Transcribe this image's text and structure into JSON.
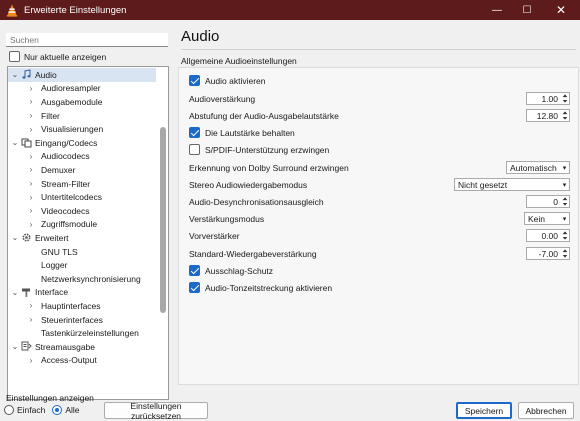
{
  "window": {
    "title": "Erweiterte Einstellungen",
    "minimize": "—",
    "maximize": "☐",
    "close": "✕"
  },
  "sidebar": {
    "search_placeholder": "Suchen",
    "only_current_label": "Nur aktuelle anzeigen",
    "only_current_checked": false,
    "tree": [
      {
        "label": "Audio",
        "level": 0,
        "expanded": true,
        "icon": "music-note-icon",
        "selected": true
      },
      {
        "label": "Audioresampler",
        "level": 1,
        "arrow": true
      },
      {
        "label": "Ausgabemodule",
        "level": 1,
        "arrow": true
      },
      {
        "label": "Filter",
        "level": 1,
        "arrow": true
      },
      {
        "label": "Visualisierungen",
        "level": 1,
        "arrow": true
      },
      {
        "label": "Eingang/Codecs",
        "level": 0,
        "expanded": true,
        "icon": "codec-icon"
      },
      {
        "label": "Audiocodecs",
        "level": 1,
        "arrow": true
      },
      {
        "label": "Demuxer",
        "level": 1,
        "arrow": true
      },
      {
        "label": "Stream-Filter",
        "level": 1,
        "arrow": true
      },
      {
        "label": "Untertitelcodecs",
        "level": 1,
        "arrow": true
      },
      {
        "label": "Videocodecs",
        "level": 1,
        "arrow": true
      },
      {
        "label": "Zugriffsmodule",
        "level": 1,
        "arrow": true
      },
      {
        "label": "Erweitert",
        "level": 0,
        "expanded": true,
        "icon": "gear-icon"
      },
      {
        "label": "GNU TLS",
        "level": 1,
        "arrow": false
      },
      {
        "label": "Logger",
        "level": 1,
        "arrow": false
      },
      {
        "label": "Netzwerksynchronisierung",
        "level": 1,
        "arrow": false
      },
      {
        "label": "Interface",
        "level": 0,
        "expanded": true,
        "icon": "brush-icon"
      },
      {
        "label": "Hauptinterfaces",
        "level": 1,
        "arrow": true
      },
      {
        "label": "Steuerinterfaces",
        "level": 1,
        "arrow": true
      },
      {
        "label": "Tastenkürzeleinstellungen",
        "level": 1,
        "arrow": false
      },
      {
        "label": "Streamausgabe",
        "level": 0,
        "expanded": true,
        "icon": "stream-icon"
      },
      {
        "label": "Access-Output",
        "level": 1,
        "arrow": true
      }
    ]
  },
  "footer": {
    "show_settings_label": "Einstellungen anzeigen",
    "simple_label": "Einfach",
    "all_label": "Alle",
    "selected_mode": "Alle",
    "reset_label": "Einstellungen zurücksetzen",
    "save_label": "Speichern",
    "cancel_label": "Abbrechen"
  },
  "panel": {
    "title": "Audio",
    "subtitle": "Allgemeine Audioeinstellungen",
    "settings": [
      {
        "type": "checkbox",
        "label": "Audio aktivieren",
        "checked": true
      },
      {
        "type": "spin",
        "label": "Audioverstärkung",
        "value": "1.00"
      },
      {
        "type": "spin",
        "label": "Abstufung der Audio-Ausgabelautstärke",
        "value": "12.80"
      },
      {
        "type": "checkbox",
        "label": "Die Lautstärke behalten",
        "checked": true
      },
      {
        "type": "checkbox",
        "label": "S/PDIF-Unterstützung erzwingen",
        "checked": false
      },
      {
        "type": "combo",
        "label": "Erkennung von Dolby Surround erzwingen",
        "value": "Automatisch"
      },
      {
        "type": "combo",
        "label": "Stereo Audiowiedergabemodus",
        "value": "Nicht gesetzt"
      },
      {
        "type": "spin",
        "label": "Audio-Desynchronisationsausgleich",
        "value": "0"
      },
      {
        "type": "combo",
        "label": "Verstärkungsmodus",
        "value": "Kein"
      },
      {
        "type": "spin",
        "label": "Vorverstärker",
        "value": "0.00"
      },
      {
        "type": "spin",
        "label": "Standard-Wiedergabeverstärkung",
        "value": "-7.00"
      },
      {
        "type": "checkbox",
        "label": "Ausschlag-Schutz",
        "checked": true
      },
      {
        "type": "checkbox",
        "label": "Audio-Tonzeitstreckung aktivieren",
        "checked": true
      }
    ]
  },
  "colors": {
    "titlebar": "#5d1b1b",
    "accent": "#1b6ac9",
    "selection": "#d9e4f2"
  }
}
